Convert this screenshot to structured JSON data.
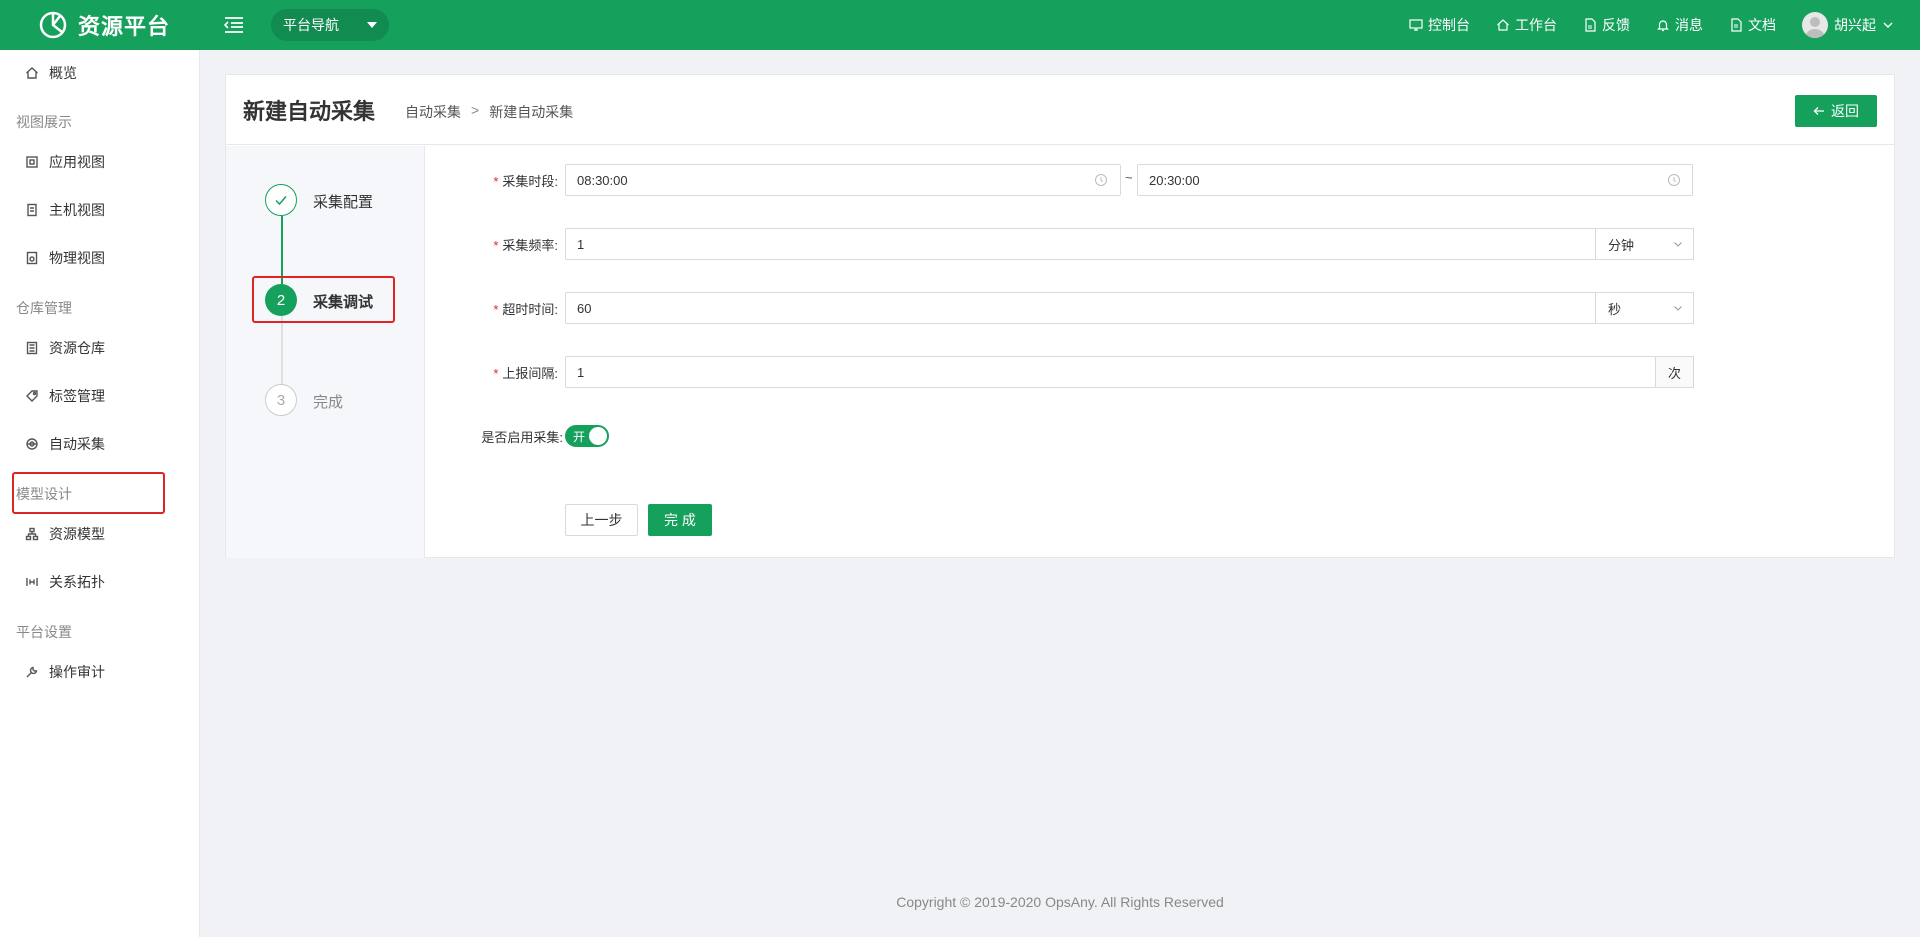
{
  "header": {
    "brand": "资源平台",
    "nav_select": "平台导航",
    "items": [
      "控制台",
      "工作台",
      "反馈",
      "消息",
      "文档"
    ],
    "user": "胡兴起"
  },
  "sidebar": {
    "items": {
      "overview": "概览",
      "group_view": "视图展示",
      "app_view": "应用视图",
      "host_view": "主机视图",
      "physical_view": "物理视图",
      "group_repo": "仓库管理",
      "resource_repo": "资源仓库",
      "tag_mgmt": "标签管理",
      "auto_collect": "自动采集",
      "group_model": "模型设计",
      "resource_model": "资源模型",
      "topology": "关系拓扑",
      "group_settings": "平台设置",
      "audit": "操作审计"
    }
  },
  "page": {
    "title": "新建自动采集",
    "breadcrumb": [
      "自动采集",
      ">",
      "新建自动采集"
    ],
    "back_label": "返回"
  },
  "steps": [
    {
      "label": "采集配置",
      "state": "done"
    },
    {
      "label": "采集调试",
      "number": "2",
      "state": "active"
    },
    {
      "label": "完成",
      "number": "3",
      "state": "pending"
    }
  ],
  "form": {
    "period_label": "采集时段:",
    "period_start": "08:30:00",
    "period_sep": "~",
    "period_end": "20:30:00",
    "freq_label": "采集频率:",
    "freq_value": "1",
    "freq_unit": "分钟",
    "timeout_label": "超时时间:",
    "timeout_value": "60",
    "timeout_unit": "秒",
    "report_label": "上报间隔:",
    "report_value": "1",
    "report_unit": "次",
    "enable_label": "是否启用采集:",
    "enable_on_text": "开",
    "prev_label": "上一步",
    "finish_label": "完 成"
  },
  "footer": "Copyright © 2019-2020 OpsAny. All Rights Reserved",
  "colors": {
    "brand": "#15a05c",
    "highlight": "#e02424"
  }
}
